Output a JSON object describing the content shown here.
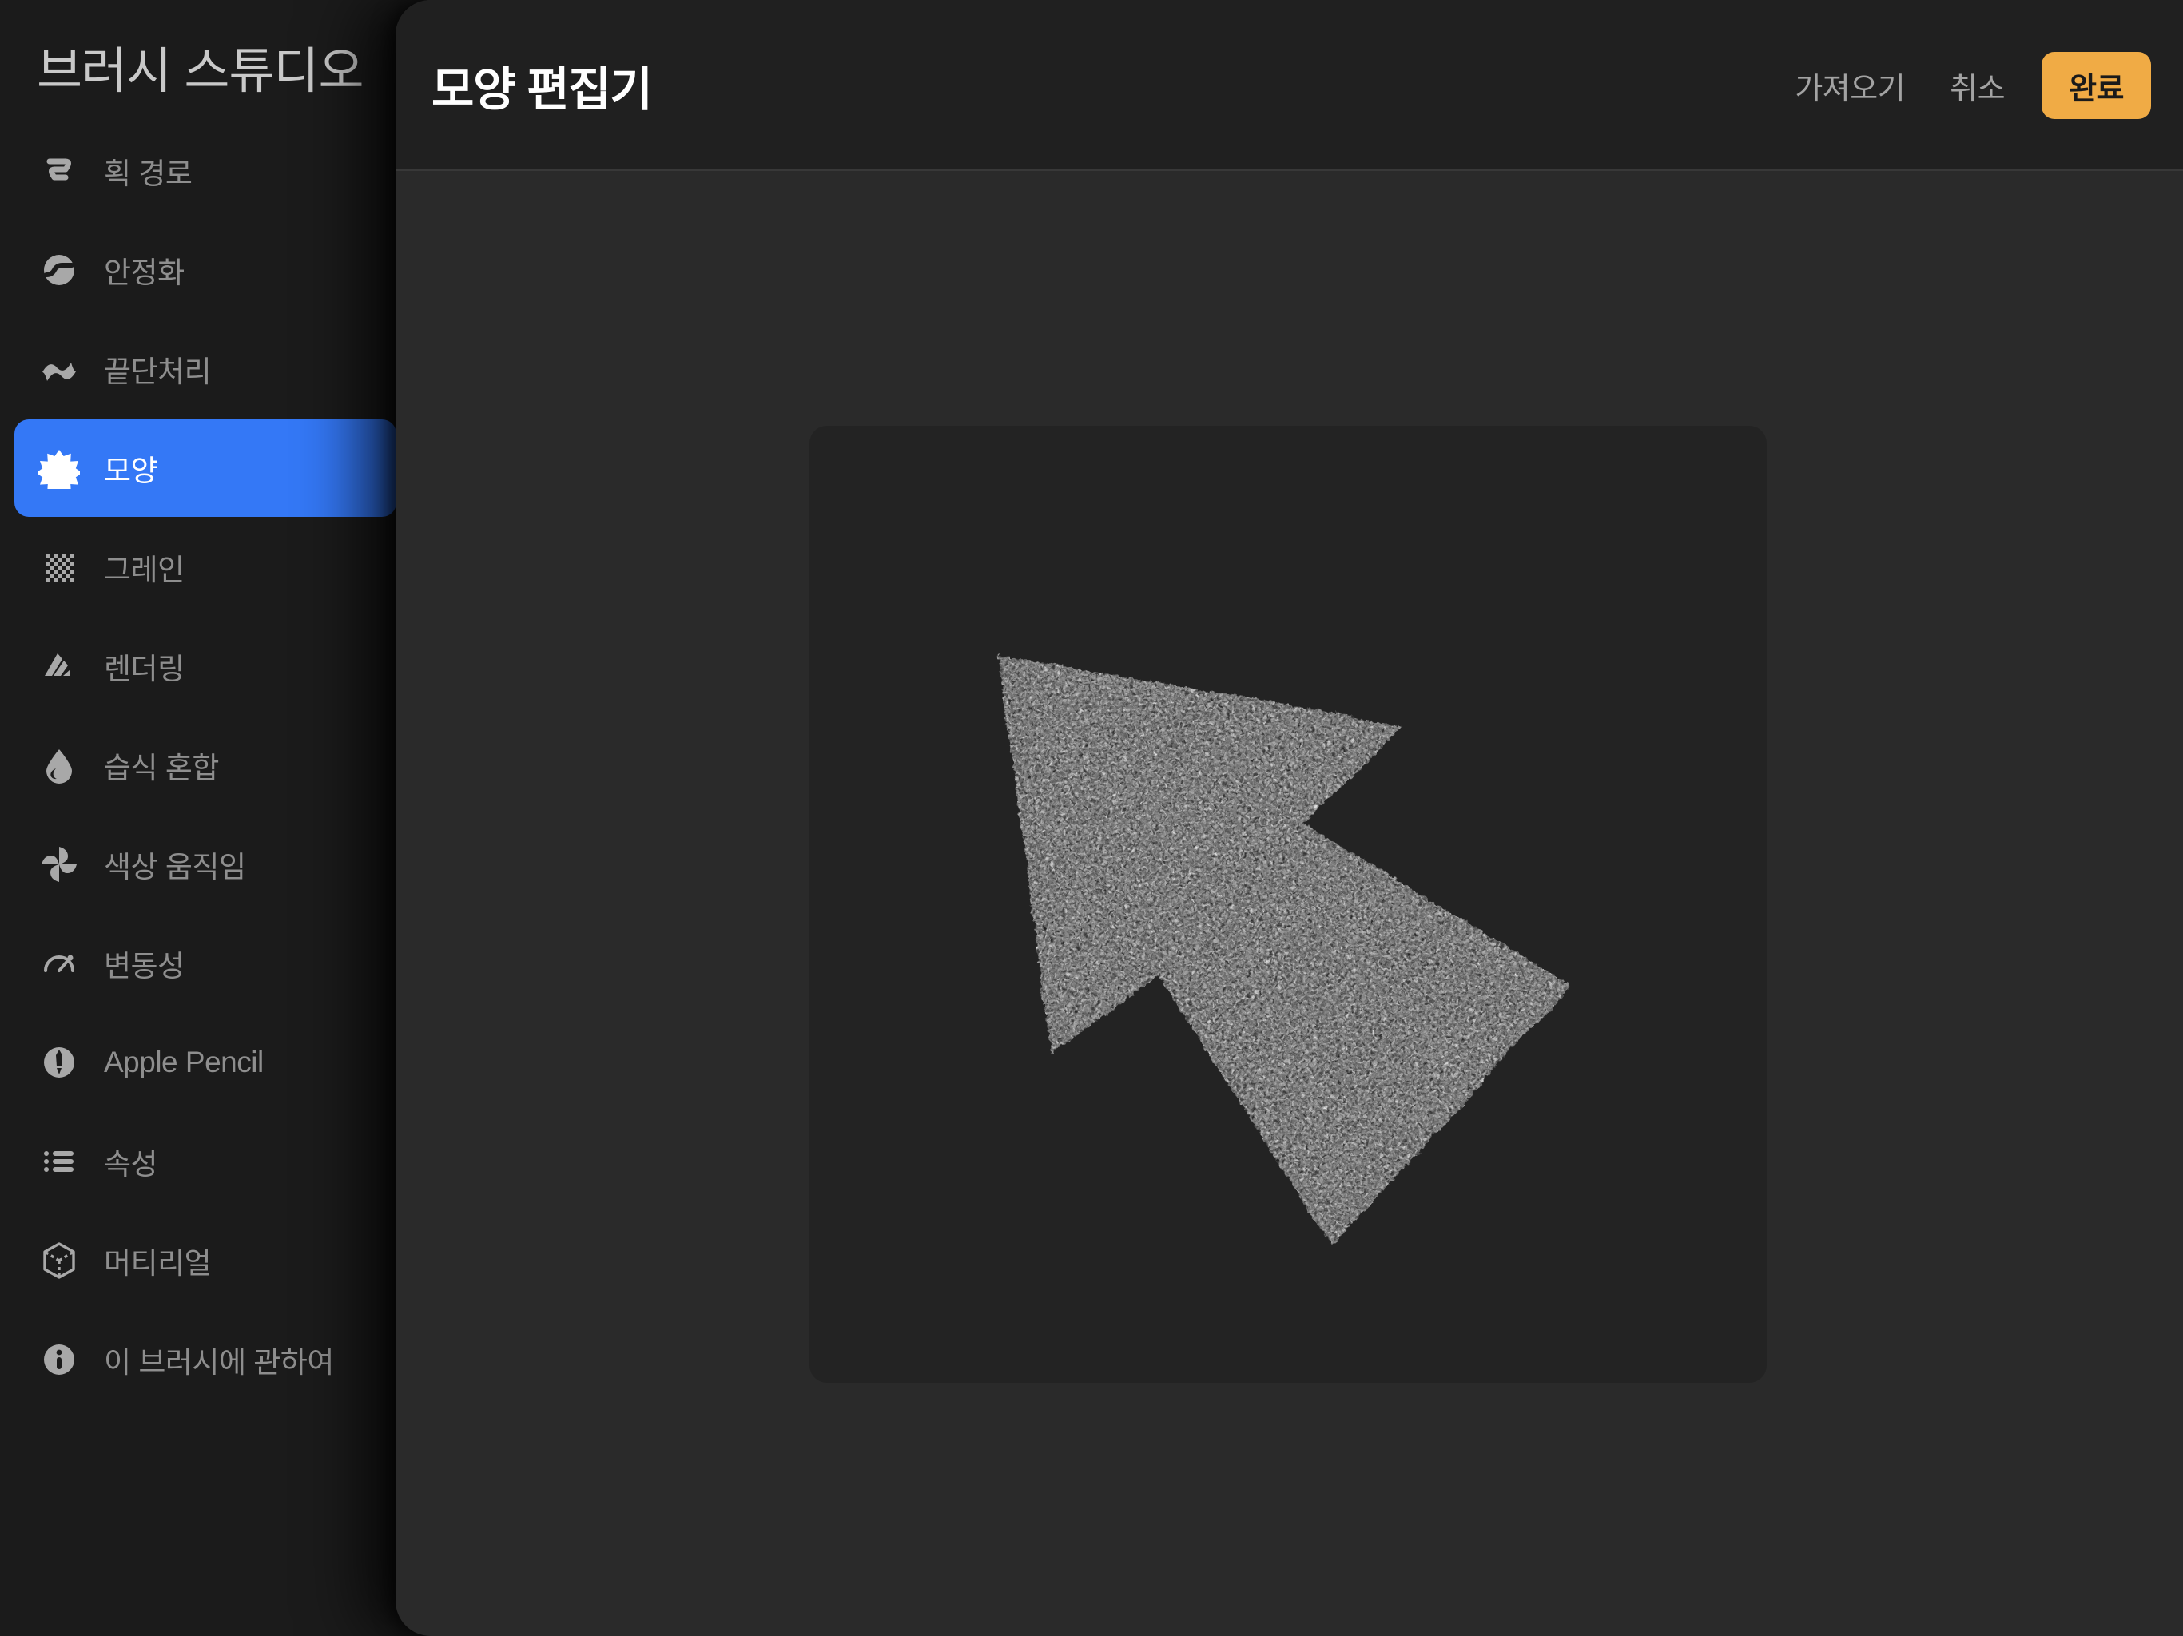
{
  "app": {
    "title": "브러시 스튜디오"
  },
  "sidebar": {
    "items": [
      {
        "label": "획 경로",
        "icon": "stroke-path-icon",
        "selected": false
      },
      {
        "label": "안정화",
        "icon": "stabilization-icon",
        "selected": false
      },
      {
        "label": "끝단처리",
        "icon": "taper-icon",
        "selected": false
      },
      {
        "label": "모양",
        "icon": "shape-icon",
        "selected": true
      },
      {
        "label": "그레인",
        "icon": "grain-icon",
        "selected": false
      },
      {
        "label": "렌더링",
        "icon": "rendering-icon",
        "selected": false
      },
      {
        "label": "습식 혼합",
        "icon": "wet-mix-icon",
        "selected": false
      },
      {
        "label": "색상 움직임",
        "icon": "color-jitter-icon",
        "selected": false
      },
      {
        "label": "변동성",
        "icon": "dynamics-icon",
        "selected": false
      },
      {
        "label": "Apple Pencil",
        "icon": "apple-pencil-icon",
        "selected": false
      },
      {
        "label": "속성",
        "icon": "properties-icon",
        "selected": false
      },
      {
        "label": "머티리얼",
        "icon": "material-icon",
        "selected": false
      },
      {
        "label": "이 브러시에 관하여",
        "icon": "about-info-icon",
        "selected": false
      }
    ]
  },
  "modal": {
    "title": "모양 편집기",
    "actions": {
      "import_label": "가져오기",
      "cancel_label": "취소",
      "done_label": "완료"
    },
    "preview": {
      "shape_name": "arrow-cursor-shape",
      "background_color": "#232323",
      "shape_color": "#ffffff"
    }
  },
  "colors": {
    "accent_selected": "#3478f6",
    "accent_done": "#f0ab45",
    "panel_bg": "#2a2a2a",
    "header_bg": "#202020",
    "sidebar_bg": "#1b1b1b"
  }
}
